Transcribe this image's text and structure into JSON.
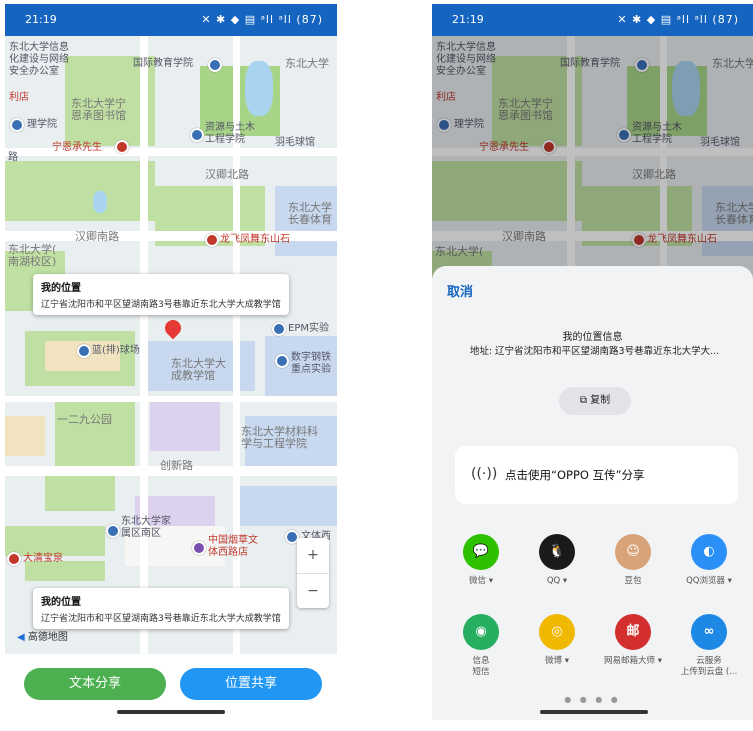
{
  "status_bar": {
    "time": "21:19",
    "icons": "✕ ✱ ◆ ▤ ᵃll ᵃll (87)"
  },
  "map": {
    "labels": {
      "l1": "东北大学信息\n化建设与网络\n安全办公室",
      "l2": "国际教育学院",
      "l3": "东北大学",
      "l4": "利店",
      "l5": "东北大学宁\n恩承图书馆",
      "l6": "理学院",
      "l7": "资源与土木\n工程学院",
      "l8": "羽毛球馆",
      "l9": "宁恩承先生",
      "l10": "汉卿北路",
      "l11": "东北大学\n长春体育",
      "l12": "汉卿南路",
      "l13": "龙飞凤舞东山石",
      "l14": "东北大学(\n南湖校区)",
      "l15": "EPM实验",
      "l16": "篮(排)球场",
      "l17": "东北大学大\n成教学馆",
      "l18": "数字钢铁\n重点实验",
      "l19": "一二九公园",
      "l20": "东北大学材料科\n学与工程学院",
      "l21": "创新路",
      "l22": "东北大学家\n属区南区",
      "l23": "中国烟草文\n体西路店",
      "l24": "文体西",
      "l25": "大清宝泉",
      "l26": "高德地图",
      "l27": "路"
    },
    "info_title": "我的位置",
    "info_address": "辽宁省沈阳市和平区望湖南路3号巷靠近东北大学大成教学馆",
    "zoom_plus": "+",
    "zoom_minus": "−"
  },
  "buttons": {
    "text_share": "文本分享",
    "location_share": "位置共享"
  },
  "share_sheet": {
    "cancel": "取消",
    "info_title": "我的位置信息",
    "info_address": "地址: 辽宁省沈阳市和平区望湖南路3号巷靠近东北大学大...",
    "copy": "复制",
    "oppo_share": "点击使用“OPPO 互传”分享",
    "apps_row1": [
      {
        "name": "微信 ▾",
        "glyph": "💬",
        "color": "#2dc100"
      },
      {
        "name": "QQ ▾",
        "glyph": "🐧",
        "color": "#1a1a1a"
      },
      {
        "name": "豆包",
        "glyph": "☺",
        "color": "#d9a37a"
      },
      {
        "name": "QQ浏览器 ▾",
        "glyph": "◐",
        "color": "#2a8ff7"
      }
    ],
    "apps_row2": [
      {
        "name": "信息\n短信",
        "glyph": "◉",
        "color": "#27ae60"
      },
      {
        "name": "微博 ▾",
        "glyph": "◎",
        "color": "#f0b800"
      },
      {
        "name": "网易邮箱大师 ▾",
        "glyph": "邮",
        "color": "#d32f2f"
      },
      {
        "name": "云服务\n上传到云盘 (...",
        "glyph": "∞",
        "color": "#1e88e5"
      }
    ],
    "dots": "● ● ● ●"
  }
}
